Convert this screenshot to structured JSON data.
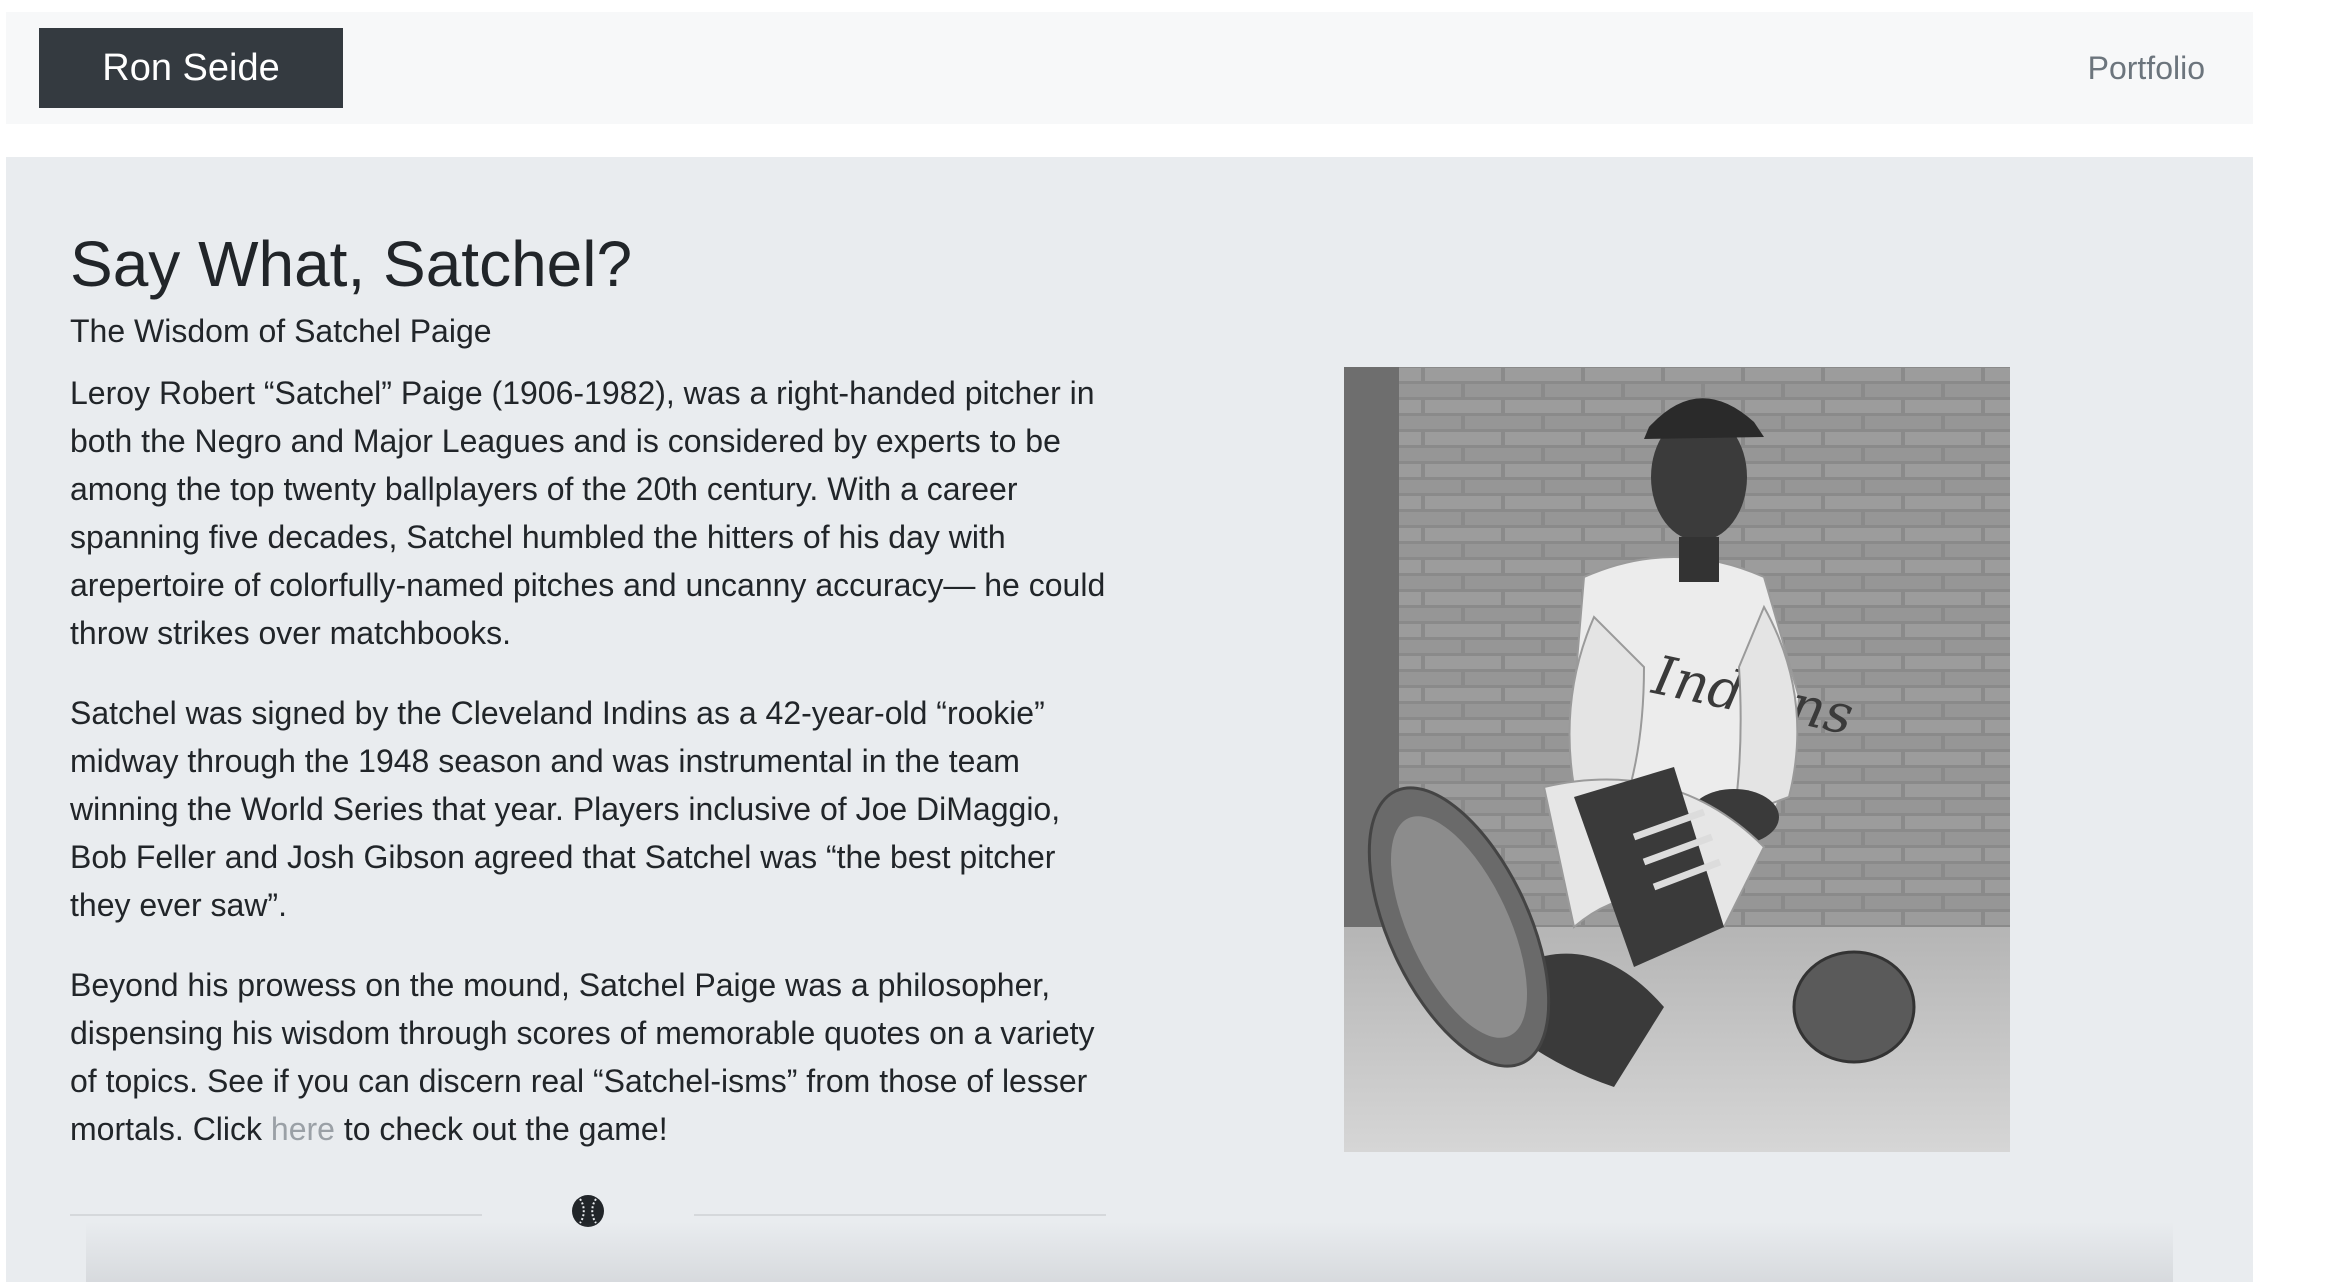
{
  "navbar": {
    "brand": "Ron Seide",
    "links": [
      "Portfolio"
    ]
  },
  "main": {
    "title": "Say What, Satchel?",
    "subtitle": "The Wisdom of Satchel Paige",
    "paragraph1": "Leroy Robert “Satchel” Paige (1906-1982), was a right-handed pitcher in both the Negro and Major Leagues and is considered by experts to be among the top twenty ballplayers of the 20th century. With a career spanning five decades, Satchel humbled the hitters of his day with arepertoire of colorfully-named pitches and uncanny accuracy— he could throw strikes over matchbooks.",
    "paragraph2": "Satchel was signed by the Cleveland Indins as a 42-year-old “rookie” midway through the 1948 season and was instrumental in the team winning the World Series that year. Players inclusive of Joe DiMaggio, Bob Feller and Josh Gibson agreed that Satchel was “the best pitcher they ever saw”.",
    "paragraph3_before": "Beyond his prowess on the mound, Satchel Paige was a philosopher, dispensing his wisdom through scores of memorable quotes on a variety of topics. See if you can discern real “Satchel-isms” from those of lesser mortals. Click ",
    "paragraph3_link": "here",
    "paragraph3_after": " to check out the game!",
    "divider_icon": "baseball-icon",
    "photo_jersey_text": "Indians",
    "photo_icon": "satchel-paige-photo"
  },
  "colors": {
    "navbar_bg": "#f7f8f9",
    "brand_bg": "#343a40",
    "jumbotron_bg": "#e9ecef",
    "link": "#9aa0a6"
  }
}
